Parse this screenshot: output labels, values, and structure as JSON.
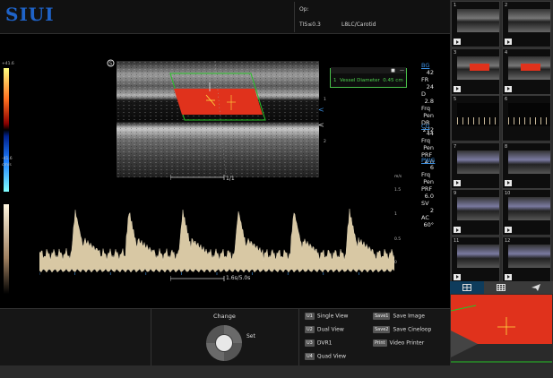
{
  "header": {
    "logo": "SIUI",
    "operator_label": "Op:",
    "tis": "TIS≤0.3",
    "preset": "L8LC/Carotid"
  },
  "measurement": {
    "index": "1",
    "label": "Vessel Diameter",
    "value": "0.45 cm"
  },
  "scale": {
    "color_top": "+41.6",
    "color_bottom": "-41.6",
    "color_unit": "cm/s",
    "depth_right": [
      "1",
      "2"
    ],
    "velocity_unit": "m/s",
    "velocity_ticks": [
      "1.5",
      "1",
      "0.5",
      "0"
    ],
    "depth_marker": "1/1",
    "sweep_marker": "1.6s/5.0s"
  },
  "params": {
    "bg": {
      "title": "BG",
      "rows": [
        [
          "FR",
          "24"
        ],
        [
          "D",
          "2.8"
        ],
        [
          "Frq",
          "Pen"
        ],
        [
          "DR",
          "272"
        ]
      ],
      "title_value": "42"
    },
    "cg": {
      "title": "CG",
      "title_value": "44",
      "rows": [
        [
          "Frq",
          "Pen"
        ],
        [
          "PRF",
          "4.0"
        ]
      ]
    },
    "pwg": {
      "title": "PWG",
      "title_value": "6",
      "rows": [
        [
          "Frq",
          "Pen"
        ],
        [
          "PRF",
          "6.0"
        ],
        [
          "SV",
          "2"
        ],
        [
          "AC",
          "60°"
        ]
      ]
    }
  },
  "panel": {
    "change": "Change",
    "set": "Set",
    "keys_left": [
      {
        "key": "U1",
        "label": "Single View"
      },
      {
        "key": "U2",
        "label": "Dual View"
      },
      {
        "key": "U3",
        "label": "DVR1"
      },
      {
        "key": "U4",
        "label": "Quad View"
      }
    ],
    "keys_right": [
      {
        "key": "Save1",
        "label": "Save Image"
      },
      {
        "key": "Save2",
        "label": "Save Cineloop"
      },
      {
        "key": "Print",
        "label": "Video Printer"
      }
    ]
  },
  "thumbnails": [
    {
      "num": "1",
      "kind": "plain",
      "play": true
    },
    {
      "num": "2",
      "kind": "plain",
      "play": true
    },
    {
      "num": "3",
      "kind": "red",
      "play": true
    },
    {
      "num": "4",
      "kind": "red",
      "play": true
    },
    {
      "num": "5",
      "kind": "wave",
      "play": false
    },
    {
      "num": "6",
      "kind": "wave",
      "play": false
    },
    {
      "num": "7",
      "kind": "pw",
      "play": true
    },
    {
      "num": "8",
      "kind": "pw",
      "play": true
    },
    {
      "num": "9",
      "kind": "pw",
      "play": true
    },
    {
      "num": "10",
      "kind": "pw",
      "play": true
    },
    {
      "num": "11",
      "kind": "pw",
      "play": true
    },
    {
      "num": "12",
      "kind": "pw",
      "play": true
    }
  ],
  "tabs": [
    "grid-large-icon",
    "grid-small-icon",
    "send-icon"
  ],
  "colors": {
    "logo": "#1f63c8",
    "color_flow": "#e0321c",
    "measure_green": "#4fd34f",
    "param_blue": "#3b8fe0",
    "spectrum": "#d8c8a4"
  }
}
